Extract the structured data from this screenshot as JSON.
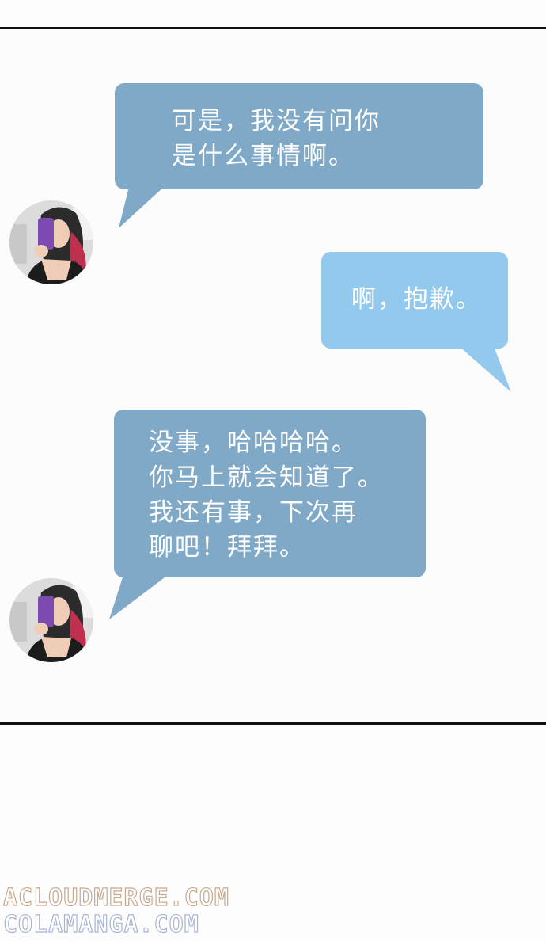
{
  "messages": [
    {
      "side": "incoming",
      "lines": [
        "可是，我没有问你",
        "是什么事情啊。"
      ]
    },
    {
      "side": "outgoing",
      "lines": [
        "啊，抱歉。"
      ]
    },
    {
      "side": "incoming",
      "lines": [
        "没事，哈哈哈哈。",
        "你马上就会知道了。",
        "我还有事，下次再",
        "聊吧！拜拜。"
      ]
    }
  ],
  "avatars": [
    {
      "icon": "woman-selfie-avatar-icon"
    },
    {
      "icon": "woman-selfie-avatar-icon"
    }
  ],
  "colors": {
    "incoming_bubble": "#7fa9c7",
    "outgoing_bubble": "#94c9ee",
    "border": "#111111",
    "watermark_1": "#c9a98c",
    "watermark_2": "#a7b4d3"
  },
  "watermarks": {
    "line1": "ACLOUDMERGE.COM",
    "line2": "COLAMANGA.COM"
  }
}
